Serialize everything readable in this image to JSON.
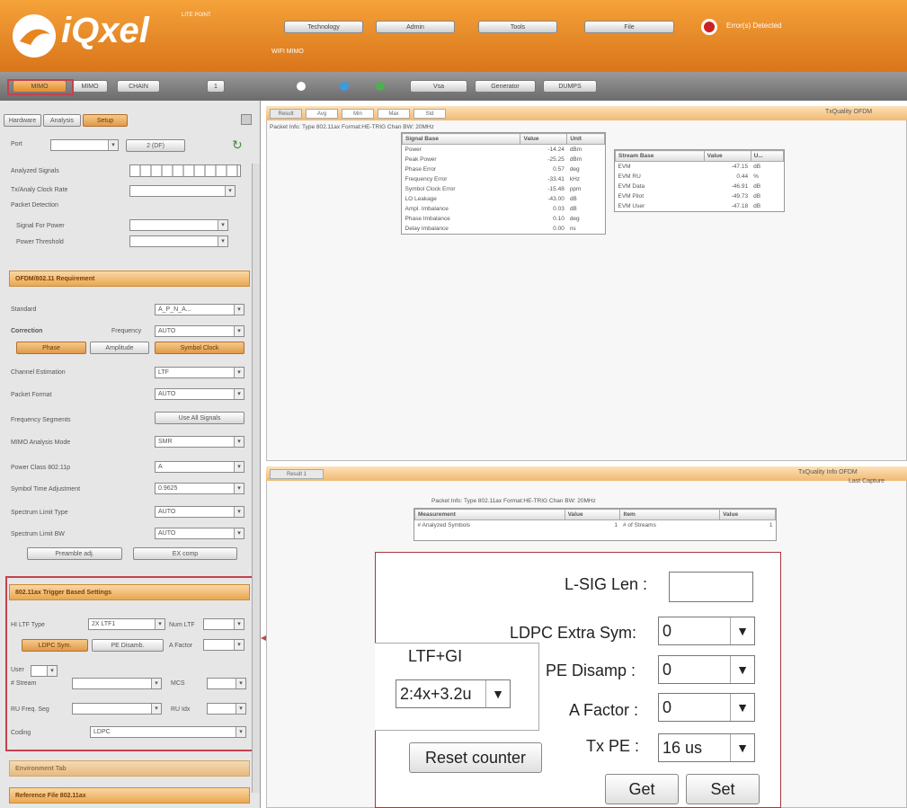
{
  "header": {
    "logo_text": "iQxel",
    "logo_tag": "LITE POINT",
    "wifi_label": "WIFI MIMO",
    "tabs": [
      "Technology",
      "Admin",
      "Tools",
      "File"
    ],
    "status_text": "Error(s) Detected"
  },
  "toolbar": {
    "buttons": [
      "MIMO",
      "MIMO",
      "CHAIN",
      "1",
      "Vsa",
      "Generator",
      "DUMPS"
    ]
  },
  "left_panel": {
    "tabs": [
      "Hardware",
      "Analysis",
      "Setup"
    ],
    "port_label": "Port",
    "port_btn": "2 (DF)",
    "analyzed_signals": "Analyzed Signals",
    "clock_rate": "Tx/Analy Clock Rate",
    "packet_detection": "Packet Detection",
    "signal_for_power": "Signal For Power",
    "power_threshold": "Power Threshold",
    "sec_80211": "OFDM/802.11 Requirement",
    "standard": "Standard",
    "standard_val": "A_P_N_A...",
    "correction": "Correction",
    "frequency": "Frequency",
    "auto": "AUTO",
    "phase_btn": "Phase",
    "amplitude_btn": "Amplitude",
    "symbol_clock_btn": "Symbol Clock",
    "channel_estimation": "Channel Estimation",
    "ltf": "LTF",
    "packet_format": "Packet Format",
    "freq_segments": "Frequency Segments",
    "use_all": "Use All Signals",
    "mimo_mode": "MIMO Analysis Mode",
    "mimo_val": "SMR",
    "power_class": "Power Class 802.11p",
    "power_class_val": "A",
    "symbol_time": "Symbol Time Adjustment",
    "symbol_time_val": "0.9625",
    "spectrum_type": "Spectrum Limit Type",
    "spectrum_bw": "Spectrum Limit BW",
    "preamble_btn": "Preamble adj.",
    "ex_comp_btn": "EX comp",
    "sec_trigger": "802.11ax Trigger Based Settings",
    "ltf_type": "HI LTF Type",
    "ltf_type_val": "2X LTF1",
    "num_ltf": "Num LTF",
    "ldpc_btn": "LDPC Sym.",
    "pe_btn": "PE Disamb.",
    "afactor": "A Factor",
    "user": "User",
    "nstream": "# Stream",
    "mcs": "MCS",
    "ru_freq": "RU Freq. Seg",
    "ru_idx": "RU Idx",
    "coding": "Coding",
    "coding_val": "LDPC",
    "sec_env": "Environment Tab",
    "sec_ref": "Reference File 802.11ax"
  },
  "results_top": {
    "tabs": [
      "Result",
      "Avg",
      "Min",
      "Max",
      "Std"
    ],
    "right_title": "TxQuality OFDM",
    "packet_info": "Packet Info: Type 802.11ax   Format:HE-TRIG   Chan BW: 20MHz",
    "table1": {
      "headers": [
        "Signal Base",
        "Value",
        "Unit"
      ],
      "rows": [
        [
          "Power",
          "-14.24",
          "dBm"
        ],
        [
          "Peak Power",
          "-25.25",
          "dBm"
        ],
        [
          "Phase Error",
          "0.57",
          "deg"
        ],
        [
          "Frequency Error",
          "-33.41",
          "kHz"
        ],
        [
          "Symbol Clock Error",
          "-15.48",
          "ppm"
        ],
        [
          "LO Leakage",
          "-43.00",
          "dB"
        ],
        [
          "Ampl. Imbalance",
          "0.03",
          "dB"
        ],
        [
          "Phase Imbalance",
          "0.10",
          "deg"
        ],
        [
          "Delay Imbalance",
          "0.00",
          "ns"
        ]
      ]
    },
    "table2": {
      "headers": [
        "Stream Base",
        "Value",
        "U..."
      ],
      "rows": [
        [
          "EVM",
          "-47.15",
          "dB"
        ],
        [
          "EVM RU",
          "0.44",
          "%"
        ],
        [
          "EVM Data",
          "-46.91",
          "dB"
        ],
        [
          "EVM Pilot",
          "-49.73",
          "dB"
        ],
        [
          "EVM User",
          "-47.18",
          "dB"
        ]
      ]
    }
  },
  "results_bottom": {
    "tab": "Result 1",
    "right_title": "TxQuality Info OFDM",
    "right_sub": "Last Capture",
    "packet_info": "Packet Info: Type 802.11ax   Format:HE-TRIG   Chan BW: 20MHz",
    "table_headers": [
      "Measurement",
      "Value",
      "Item",
      "Value"
    ],
    "row1": [
      "# Analyzed Symbols",
      "1",
      "# of Streams",
      "1"
    ],
    "row2": [
      "",
      "",
      "",
      ""
    ]
  },
  "popup": {
    "lsig_label": "L-SIG Len :",
    "lsig_value": "",
    "ldpc_label": "LDPC Extra Sym:",
    "ldpc_value": "0",
    "ltf_gi_label": "LTF+GI",
    "ltf_gi_value": "2:4x+3.2u",
    "pe_label": "PE Disamp :",
    "pe_value": "0",
    "afactor_label": "A Factor :",
    "afactor_value": "0",
    "txpe_label": "Tx PE :",
    "txpe_value": "16 us",
    "reset_btn": "Reset counter",
    "get_btn": "Get",
    "set_btn": "Set"
  },
  "colors": {
    "accent_orange": "#e8851f",
    "callout_red": "#c3424e"
  }
}
